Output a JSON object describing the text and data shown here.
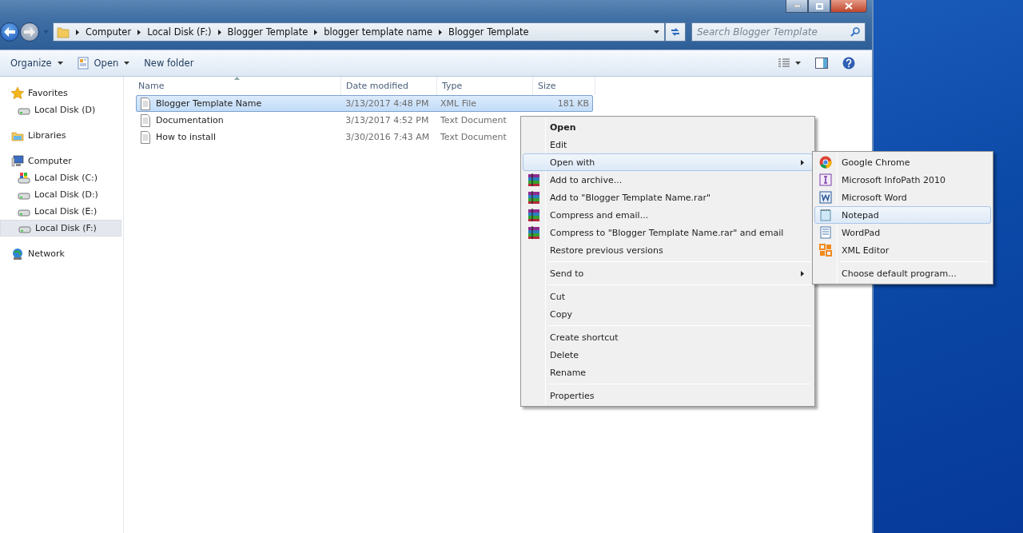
{
  "address_bar": {
    "crumbs": [
      "Computer",
      "Local Disk (F:)",
      "Blogger Template",
      "blogger template name",
      "Blogger Template"
    ]
  },
  "search": {
    "placeholder": "Search Blogger Template"
  },
  "toolbar": {
    "buttons": [
      {
        "label": "Organize",
        "dropdown": true
      },
      {
        "label": "Open",
        "dropdown": true
      },
      {
        "label": "New folder",
        "dropdown": false
      }
    ]
  },
  "sidebar": {
    "groups": [
      {
        "label": "Favorites",
        "selected": false,
        "children": [
          {
            "label": "Local Disk (D)",
            "selected": false
          }
        ]
      },
      {
        "label": "Libraries",
        "selected": false
      },
      {
        "label": "Computer",
        "selected": false,
        "children": [
          {
            "label": "Local Disk (C:)",
            "selected": false
          },
          {
            "label": "Local Disk (D:)",
            "selected": false
          },
          {
            "label": "Local Disk (E:)",
            "selected": false
          },
          {
            "label": "Local Disk (F:)",
            "selected": true
          }
        ]
      },
      {
        "label": "Network",
        "selected": false
      }
    ]
  },
  "table": {
    "columns": [
      "Name",
      "Date modified",
      "Type",
      "Size"
    ],
    "rows": [
      {
        "name": "Blogger Template Name",
        "date": "3/13/2017 4:48 PM",
        "type": "XML File",
        "size": "181 KB",
        "selected": true
      },
      {
        "name": "Documentation",
        "date": "3/13/2017 4:52 PM",
        "type": "Text Document",
        "selected": false
      },
      {
        "name": "How to install",
        "date": "3/30/2016 7:43 AM",
        "type": "Text Document",
        "selected": false
      }
    ]
  },
  "context_menu": {
    "items": [
      {
        "kind": "default",
        "label": "Open",
        "selected": false,
        "submenu": false
      },
      {
        "kind": "item",
        "label": "Edit",
        "selected": false,
        "submenu": false
      },
      {
        "kind": "item",
        "label": "Open with",
        "selected": true,
        "submenu": true
      },
      {
        "kind": "archive",
        "label": "Add to archive...",
        "selected": false,
        "submenu": false
      },
      {
        "kind": "archive",
        "label": "Add to \"Blogger Template Name.rar\"",
        "selected": false,
        "submenu": false
      },
      {
        "kind": "archive",
        "label": "Compress and email...",
        "selected": false,
        "submenu": false
      },
      {
        "kind": "archive",
        "label": "Compress to \"Blogger Template Name.rar\" and email",
        "selected": false,
        "submenu": false
      },
      {
        "kind": "item",
        "label": "Restore previous versions",
        "selected": false,
        "submenu": false
      },
      {
        "kind": "separator"
      },
      {
        "kind": "item",
        "label": "Send to",
        "selected": false,
        "submenu": true
      },
      {
        "kind": "separator"
      },
      {
        "kind": "item",
        "label": "Cut",
        "selected": false,
        "submenu": false
      },
      {
        "kind": "item",
        "label": "Copy",
        "selected": false,
        "submenu": false
      },
      {
        "kind": "separator"
      },
      {
        "kind": "item",
        "label": "Create shortcut",
        "selected": false,
        "submenu": false
      },
      {
        "kind": "item",
        "label": "Delete",
        "selected": false,
        "submenu": false
      },
      {
        "kind": "item",
        "label": "Rename",
        "selected": false,
        "submenu": false
      },
      {
        "kind": "separator"
      },
      {
        "kind": "item",
        "label": "Properties",
        "selected": false,
        "submenu": false
      }
    ]
  },
  "open_with_menu": {
    "items": [
      {
        "kind": "app",
        "label": "Google Chrome",
        "selected": false
      },
      {
        "kind": "app",
        "label": "Microsoft InfoPath 2010",
        "selected": false
      },
      {
        "kind": "app",
        "label": "Microsoft Word",
        "selected": false
      },
      {
        "kind": "app",
        "label": "Notepad",
        "selected": true
      },
      {
        "kind": "app",
        "label": "WordPad",
        "selected": false
      },
      {
        "kind": "app",
        "label": "XML Editor",
        "selected": false
      },
      {
        "kind": "separator"
      },
      {
        "kind": "item",
        "label": "Choose default program...",
        "selected": false
      }
    ]
  }
}
